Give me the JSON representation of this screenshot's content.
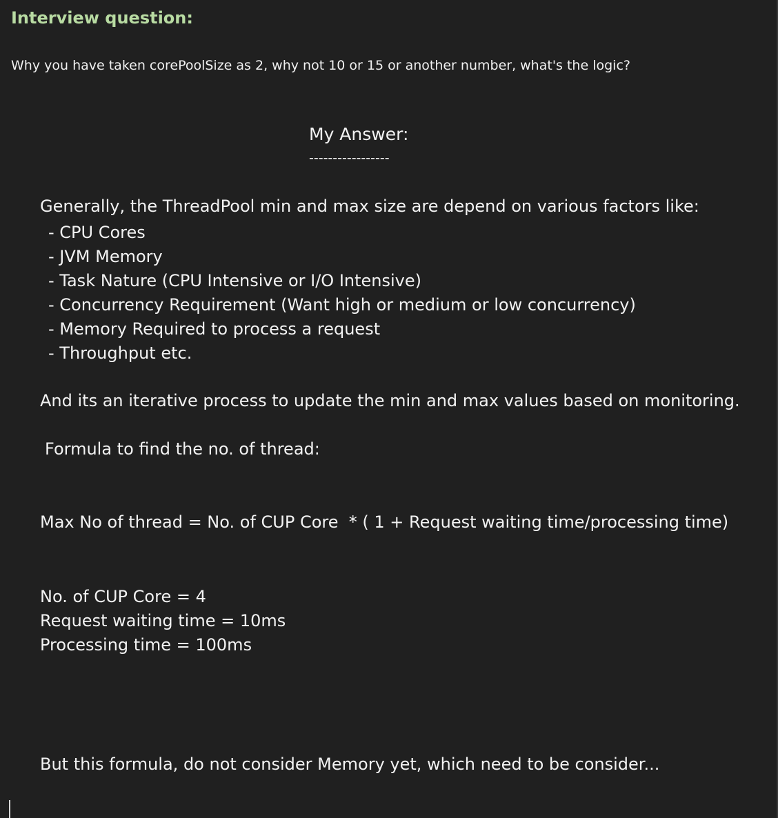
{
  "question": {
    "heading": "Interview question:",
    "text": "Why you have taken corePoolSize as 2, why not 10 or 15 or another number, what's the logic?"
  },
  "answer": {
    "title": "My Answer:",
    "rule": "-----------------",
    "intro": "Generally, the ThreadPool min and max size are depend on various factors like:",
    "factors": [
      "- CPU Cores",
      "- JVM Memory",
      "- Task Nature (CPU Intensive or I/O Intensive)",
      "- Concurrency Requirement (Want high or medium or low concurrency)",
      "- Memory Required to process a request",
      "- Throughput etc."
    ],
    "iterative": "And its an iterative process to update the min and max values based on monitoring.",
    "formula_heading": "Formula to find the no. of thread:",
    "formula": "Max No of thread = No. of CUP Core  * ( 1 + Request waiting time/processing time)",
    "inputs": [
      "No. of CUP Core = 4",
      "Request waiting time = 10ms",
      "Processing time = 100ms"
    ],
    "closing": "But this formula, do not consider Memory yet, which need to be consider..."
  }
}
